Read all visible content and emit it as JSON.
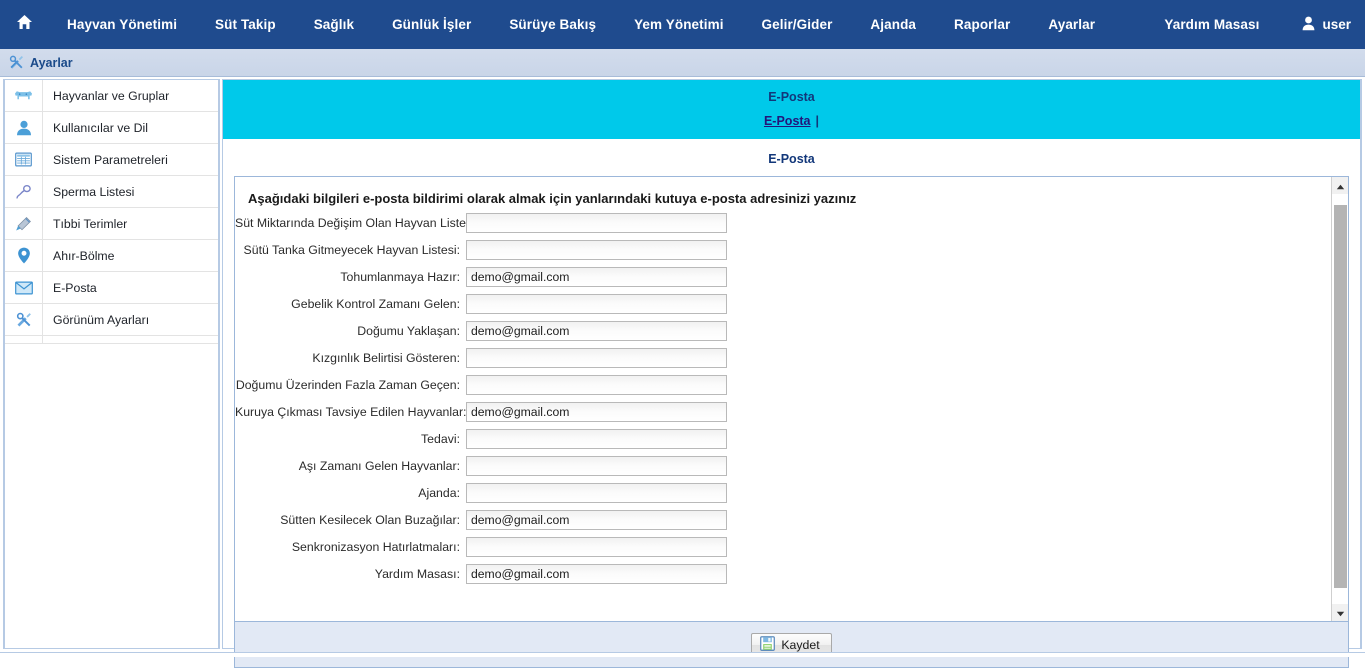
{
  "topnav": {
    "home_icon": "home-icon",
    "items": [
      {
        "label": "Hayvan Yönetimi"
      },
      {
        "label": "Süt Takip"
      },
      {
        "label": "Sağlık"
      },
      {
        "label": "Günlük İşler"
      },
      {
        "label": "Sürüye Bakış"
      },
      {
        "label": "Yem Yönetimi"
      },
      {
        "label": "Gelir/Gider"
      },
      {
        "label": "Ajanda"
      },
      {
        "label": "Raporlar"
      },
      {
        "label": "Ayarlar"
      }
    ],
    "help_label": "Yardım Masası",
    "user_label": "user",
    "user_icon": "user-icon",
    "bg_color": "#1f4b8e"
  },
  "breadcrumb": {
    "icon": "tools-icon",
    "label": "Ayarlar"
  },
  "sidebar": {
    "items": [
      {
        "label": "Hayvanlar ve Gruplar",
        "icon": "cow-icon"
      },
      {
        "label": "Kullanıcılar ve Dil",
        "icon": "user-icon"
      },
      {
        "label": "Sistem Parametreleri",
        "icon": "table-icon"
      },
      {
        "label": "Sperma Listesi",
        "icon": "sperm-icon"
      },
      {
        "label": "Tıbbi Terimler",
        "icon": "syringe-icon"
      },
      {
        "label": "Ahır-Bölme",
        "icon": "map-pin-icon"
      },
      {
        "label": "E-Posta",
        "icon": "envelope-icon"
      },
      {
        "label": "Görünüm Ayarları",
        "icon": "tools-icon"
      }
    ]
  },
  "main": {
    "header_title": "E-Posta",
    "tabs": [
      {
        "label": "E-Posta",
        "active": true
      }
    ],
    "tab_separator": "|",
    "subtitle": "E-Posta",
    "accent_cyan": "#00c9ea",
    "form": {
      "heading": "Aşağıdaki bilgileri e-posta bildirimi olarak almak için yanlarındaki kutuya e-posta adresinizi yazınız",
      "rows": [
        {
          "label": "Süt Miktarında Değişim Olan Hayvan Listesi :",
          "value": ""
        },
        {
          "label": "Sütü Tanka Gitmeyecek Hayvan Listesi:",
          "value": ""
        },
        {
          "label": "Tohumlanmaya Hazır:",
          "value": "demo@gmail.com"
        },
        {
          "label": "Gebelik Kontrol Zamanı Gelen:",
          "value": ""
        },
        {
          "label": "Doğumu Yaklaşan:",
          "value": "demo@gmail.com"
        },
        {
          "label": "Kızgınlık Belirtisi Gösteren:",
          "value": ""
        },
        {
          "label": "Doğumu Üzerinden Fazla Zaman Geçen:",
          "value": ""
        },
        {
          "label": "Kuruya Çıkması Tavsiye Edilen Hayvanlar:",
          "value": "demo@gmail.com"
        },
        {
          "label": "Tedavi:",
          "value": ""
        },
        {
          "label": "Aşı Zamanı Gelen Hayvanlar:",
          "value": ""
        },
        {
          "label": "Ajanda:",
          "value": ""
        },
        {
          "label": "Sütten Kesilecek Olan Buzağılar:",
          "value": "demo@gmail.com"
        },
        {
          "label": "Senkronizasyon Hatırlatmaları:",
          "value": ""
        },
        {
          "label": "Yardım Masası:",
          "value": "demo@gmail.com"
        }
      ]
    },
    "save_button": {
      "label": "Kaydet",
      "icon": "floppy-disk-icon"
    },
    "scrollbar": {
      "up_icon": "chevron-up-icon",
      "down_icon": "chevron-down-icon"
    }
  }
}
